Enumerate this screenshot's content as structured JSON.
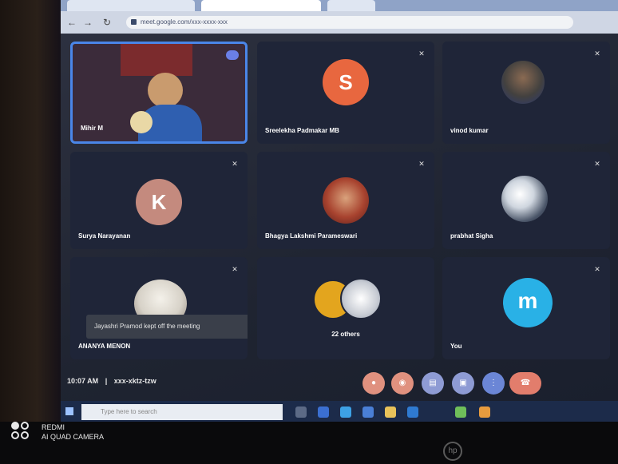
{
  "browser": {
    "tabs": [
      "",
      "",
      ""
    ],
    "url": "meet.google.com/xxx-xxxx-xxx"
  },
  "tiles": [
    {
      "name": "Mihir M",
      "type": "video"
    },
    {
      "name": "Sreelekha Padmakar MB",
      "initial": "S",
      "color": "#e8673f",
      "type": "avatar"
    },
    {
      "name": "vinod kumar",
      "type": "photo"
    },
    {
      "name": "Surya Narayanan",
      "initial": "K",
      "color": "#c48a7e",
      "type": "avatar"
    },
    {
      "name": "Bhagya Lakshmi Parameswari",
      "type": "photo"
    },
    {
      "name": "prabhat Sigha",
      "type": "photo"
    },
    {
      "name": "ANANYA MENON",
      "type": "photo"
    },
    {
      "name": "22 others",
      "type": "group"
    },
    {
      "name": "You",
      "initial": "m",
      "color": "#29b1e6",
      "type": "avatar"
    }
  ],
  "notification": "Jayashri Pramod kept off the meeting",
  "meeting": {
    "time": "10:07 AM",
    "code": "xxx-xktz-tzw"
  },
  "controls": [
    {
      "icon": "mic-icon",
      "color": "#e0917f"
    },
    {
      "icon": "camera-icon",
      "color": "#e0917f"
    },
    {
      "icon": "captions-icon",
      "color": "#8e9bd4"
    },
    {
      "icon": "present-icon",
      "color": "#8e9bd4"
    },
    {
      "icon": "more-icon",
      "color": "#6b86d6"
    },
    {
      "icon": "end-call-icon",
      "color": "#e27d6c"
    }
  ],
  "taskbar": {
    "search_placeholder": "Type here to search"
  },
  "watermark": {
    "line1": "REDMI",
    "line2": "AI QUAD CAMERA"
  }
}
